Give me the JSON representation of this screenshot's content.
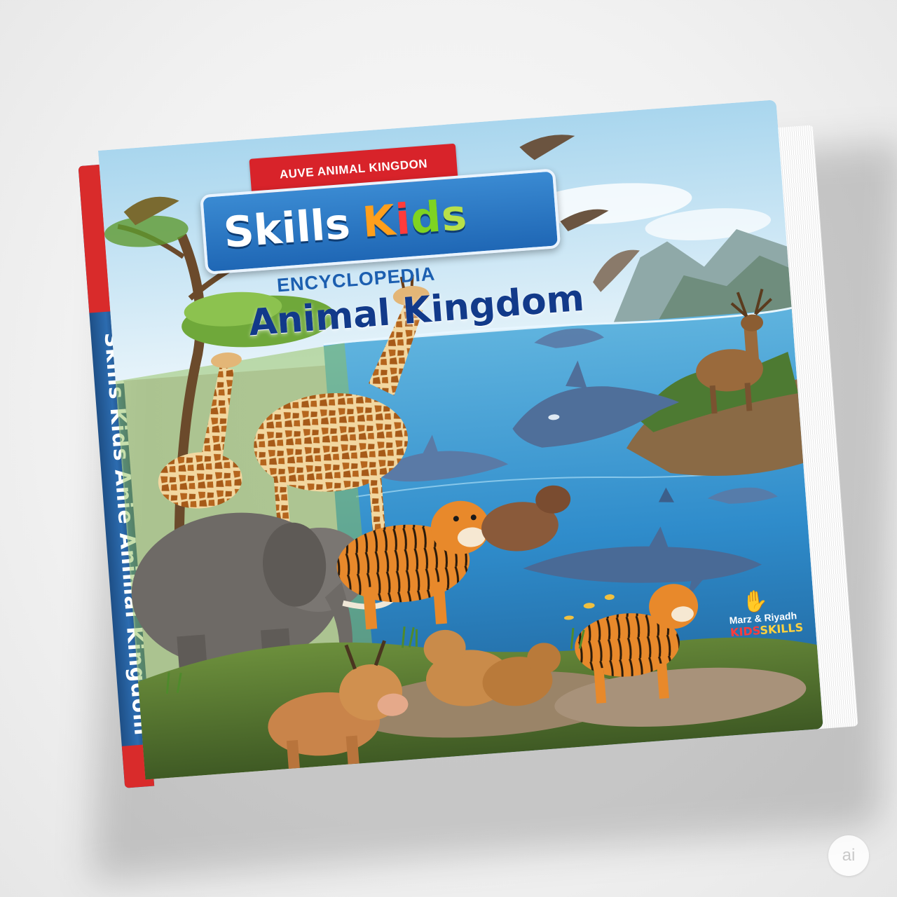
{
  "cover": {
    "ribbon_text": "AUVE ANIMAL KINGDON",
    "title_part1": "Skills",
    "title_kids_letters": [
      "K",
      "i",
      "d",
      "s"
    ],
    "subtitle": "ENCYCLOPEDIA",
    "main_title": "Animal Kingdom"
  },
  "spine": {
    "text": "Skills Kids Anie Animal Kingdom"
  },
  "publisher": {
    "logo": "hand-logo-icon",
    "names": "Marz & Riyadh",
    "brand_kids": "KIDS",
    "brand_skills": "SKILLS"
  },
  "watermark": {
    "text": "ai"
  },
  "colors": {
    "ribbon": "#d8232a",
    "title_box": "#1f67b5",
    "main_title": "#123a8a",
    "subtitle": "#1c5fb0",
    "spine": "#2c6cb0",
    "sea": "#2f8ccb",
    "sky": "#bfe0f2"
  },
  "illustration": {
    "animals": [
      "giraffe-icon",
      "giraffe-icon",
      "elephant-icon",
      "tiger-icon",
      "tiger-icon",
      "dolphin-icon",
      "dolphin-icon",
      "dolphin-icon",
      "bird-icon",
      "deer-icon",
      "calf-icon",
      "cub-icon"
    ]
  }
}
